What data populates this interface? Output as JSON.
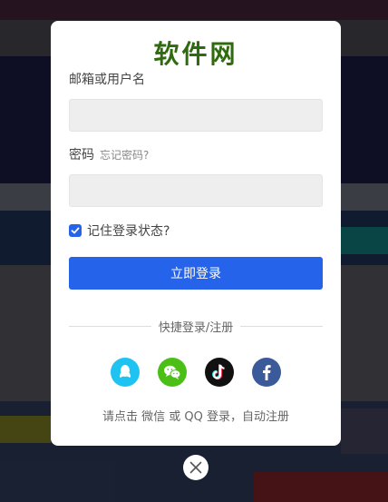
{
  "login_modal": {
    "logo_text": "软件网",
    "username_label": "邮箱或用户名",
    "username_value": "",
    "password_label": "密码",
    "forgot_link": "忘记密码?",
    "password_value": "",
    "remember_label": "记住登录状态?",
    "remember_checked": true,
    "login_button": "立即登录",
    "quick_login_label": "快捷登录/注册",
    "social_icons": [
      "qq-icon",
      "wechat-icon",
      "tiktok-icon",
      "facebook-icon"
    ],
    "hint_text": "请点击 微信 或 QQ 登录，自动注册",
    "close_icon": "close-icon"
  },
  "colors": {
    "accent": "#2563eb",
    "logo": "#2f6b0e",
    "qq": "#1ec3f2",
    "wechat": "#4cbf17",
    "tiktok": "#111111",
    "facebook": "#3b5a99"
  }
}
